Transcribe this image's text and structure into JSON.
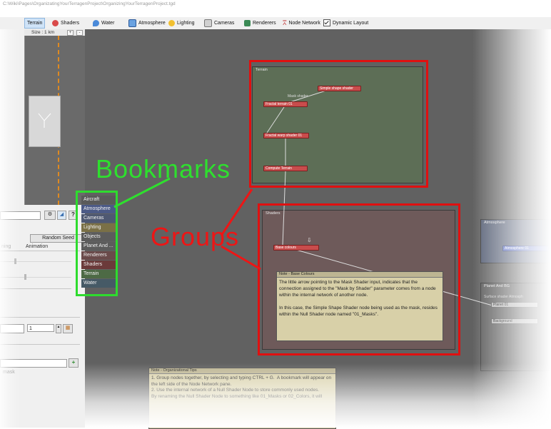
{
  "window": {
    "title_path": "C:\\Wiki\\Pages\\OrganizatingYourTerragenProject\\OrganizingYourTerragenProject.tgd"
  },
  "toolbar": {
    "items": [
      {
        "label": "Terrain",
        "icon": "terrain-icon",
        "active": true
      },
      {
        "label": "Shaders",
        "icon": "shaders-icon"
      },
      {
        "label": "Water",
        "icon": "water-icon"
      },
      {
        "label": "Atmosphere",
        "icon": "atmosphere-icon"
      },
      {
        "label": "Lighting",
        "icon": "lighting-icon"
      },
      {
        "label": "Cameras",
        "icon": "cameras-icon"
      },
      {
        "label": "Renderers",
        "icon": "renderers-icon"
      },
      {
        "label": "Node Network",
        "icon": "node-network-icon"
      }
    ],
    "dynamic_layout_label": "Dynamic Layout"
  },
  "left_panel": {
    "size_label": "Size : 1 km",
    "zoom_in": "+",
    "zoom_out": "-",
    "random_seed_label": "Random Seed",
    "tabs": [
      "ning",
      "Animation"
    ],
    "spin_value": "1",
    "bottom_text": "mask"
  },
  "annotations": {
    "bookmarks": "Bookmarks",
    "groups": "Groups"
  },
  "bookmarks": [
    {
      "label": "Aircraft",
      "color": "#5a5a5a"
    },
    {
      "label": "Atmosphere",
      "color": "#4c5a86"
    },
    {
      "label": "Cameras",
      "color": "#4e5872"
    },
    {
      "label": "Lighting",
      "color": "#7a7046"
    },
    {
      "label": "Objects",
      "color": "#5c5c5c"
    },
    {
      "label": "Planet And ...",
      "color": "#5c5c5c"
    },
    {
      "label": "Renderers",
      "color": "#6a4a4a"
    },
    {
      "label": "Shaders",
      "color": "#6b3a3a"
    },
    {
      "label": "Terrain",
      "color": "#4d6a45"
    },
    {
      "label": "Water",
      "color": "#465a66"
    }
  ],
  "groups": {
    "terrain": {
      "title": "Terrain",
      "nodes": [
        "Simple shape shader",
        "Fractal terrain 01",
        "Fractal warp shader 01",
        "Compute Terrain"
      ],
      "port_label": "Mask shader"
    },
    "shaders": {
      "title": "Shaders",
      "nodes": [
        "Base colours"
      ]
    },
    "atmosphere": {
      "title": "Atmosphere",
      "nodes": [
        "Atmosphere 01"
      ]
    },
    "planet": {
      "title": "Planet And BG",
      "nodes": [
        "Planet 01",
        "Background"
      ],
      "port_label": "Surface shader  Atmosph"
    }
  },
  "notes": {
    "base_colours": {
      "title": "Note - Base Colours",
      "body": "The little arrow pointing to the Mask Shader input, indicates that the connection assigned to the \"Mask by Shader\" parameter comes from a node within the internal network of another node.\n\nIn this case, the Simple Shape Shader node being used as the mask, resides within the Null Shader node named \"01_Masks\"."
    },
    "org_tips": {
      "title": "Note - Organizational Tips",
      "body": "1. Group nodes together, by selecting and typing CTRL + G.  A bookmark will appear on the left side of the Node Network pane.\n2. Use the internal network of a Null Shader Node to store commonly used nodes.\nBy renaming the Null Shader Node to something like 01_Masks or 02_Colors, it will"
    }
  },
  "colors": {
    "canvas": "#616161",
    "bookmark_highlight": "#2edc2e",
    "group_highlight": "#e01010",
    "terrain_group": "#5d6e56",
    "shaders_group": "#6e5a5a",
    "atmosphere_group": "#5a6378",
    "planet_group": "#5e5e5e",
    "node_red": "#c84c4c",
    "node_blue": "#5b6fc4"
  }
}
